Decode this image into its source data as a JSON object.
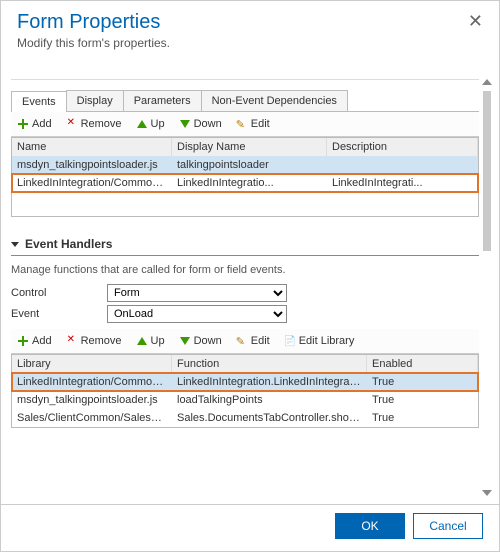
{
  "dialog": {
    "title": "Form Properties",
    "subtitle": "Modify this form's properties.",
    "close": "✕"
  },
  "tabs": {
    "t0": "Events",
    "t1": "Display",
    "t2": "Parameters",
    "t3": "Non-Event Dependencies"
  },
  "toolbar1": {
    "add": "Add",
    "remove": "Remove",
    "up": "Up",
    "down": "Down",
    "edit": "Edit"
  },
  "grid1": {
    "h0": "Name",
    "h1": "Display Name",
    "h2": "Description",
    "r0": {
      "c0": "msdyn_talkingpointsloader.js",
      "c1": "talkingpointsloader",
      "c2": ""
    },
    "r1": {
      "c0": "LinkedInIntegration/Common/msdyn_L...",
      "c1": "LinkedInIntegratio...",
      "c2": "LinkedInIntegrati..."
    }
  },
  "section": {
    "title": "Event Handlers",
    "desc": "Manage functions that are called for form or field events."
  },
  "fields": {
    "controlLabel": "Control",
    "controlValue": "Form",
    "eventLabel": "Event",
    "eventValue": "OnLoad"
  },
  "toolbar2": {
    "add": "Add",
    "remove": "Remove",
    "up": "Up",
    "down": "Down",
    "edit": "Edit",
    "editLib": "Edit Library"
  },
  "grid2": {
    "h0": "Library",
    "h1": "Function",
    "h2": "Enabled",
    "r0": {
      "c0": "LinkedInIntegration/Common/msdyn_L...",
      "c1": "LinkedInIntegration.LinkedInIntegration...",
      "c2": "True"
    },
    "r1": {
      "c0": "msdyn_talkingpointsloader.js",
      "c1": "loadTalkingPoints",
      "c2": "True"
    },
    "r2": {
      "c0": "Sales/ClientCommon/Sales_ClientCom...",
      "c1": "Sales.DocumentsTabController.shouldS...",
      "c2": "True"
    }
  },
  "footer": {
    "ok": "OK",
    "cancel": "Cancel"
  }
}
